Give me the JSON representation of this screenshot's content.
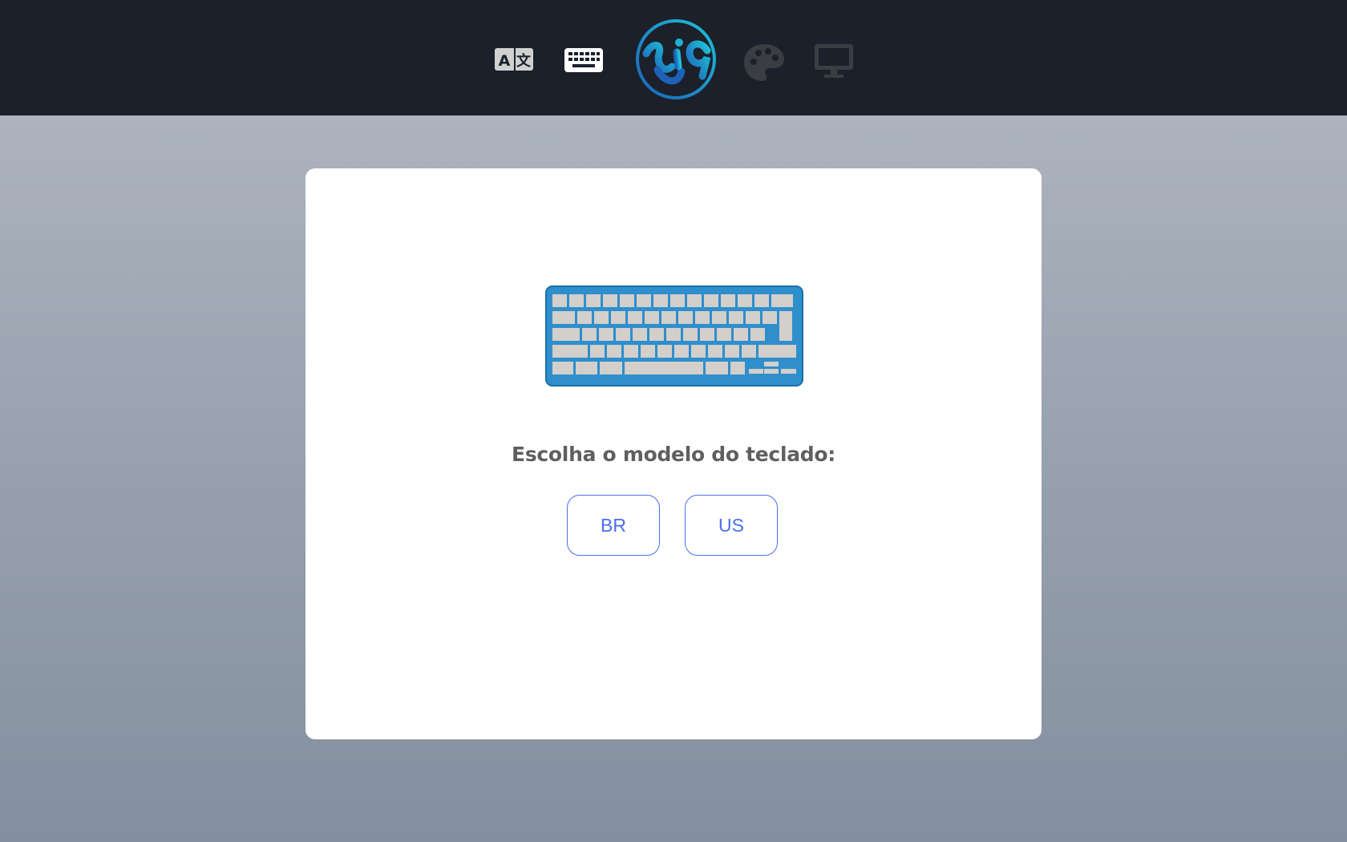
{
  "header": {
    "icons": [
      {
        "name": "language-icon",
        "state": "inactive"
      },
      {
        "name": "keyboard-icon",
        "state": "active"
      },
      {
        "name": "logo",
        "state": "brand"
      },
      {
        "name": "palette-icon",
        "state": "disabled"
      },
      {
        "name": "monitor-icon",
        "state": "disabled"
      }
    ],
    "logo_text": "sig"
  },
  "main": {
    "illustration": "keyboard-illustration",
    "prompt": "Escolha o modelo do teclado:",
    "options": [
      {
        "label": "BR"
      },
      {
        "label": "US"
      }
    ]
  },
  "colors": {
    "header_bg": "#1b202b",
    "accent": "#4a6ef0",
    "keyboard_body": "#2e8fcc",
    "keycap": "#d3cfca",
    "logo_ring": "#1fa7cf"
  }
}
